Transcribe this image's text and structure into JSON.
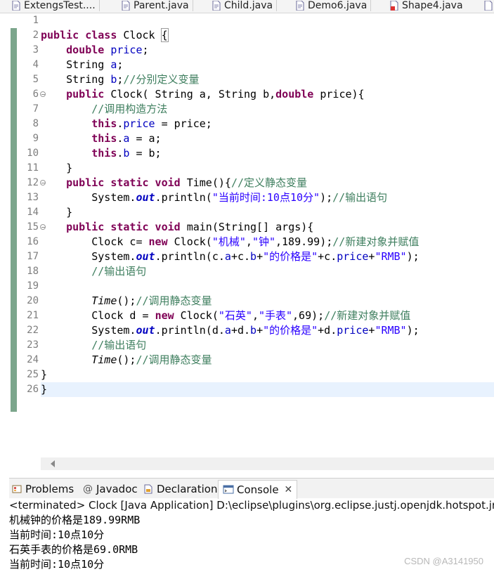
{
  "editor_tabs": [
    {
      "label": "ExtengsTest....",
      "icon": "java-file-icon"
    },
    {
      "label": "Parent.java",
      "icon": "java-file-icon"
    },
    {
      "label": "Child.java",
      "icon": "java-file-icon"
    },
    {
      "label": "Demo6.java",
      "icon": "java-file-icon"
    },
    {
      "label": "Shape4.java",
      "icon": "java-file-error-icon"
    }
  ],
  "line_numbers": [
    "1",
    "2",
    "3",
    "4",
    "5",
    "6",
    "7",
    "8",
    "9",
    "10",
    "11",
    "12",
    "13",
    "14",
    "15",
    "16",
    "17",
    "18",
    "19",
    "20",
    "21",
    "22",
    "23",
    "24",
    "25",
    "26"
  ],
  "code": {
    "l2_a": "public class",
    "l2_b": " Clock ",
    "l2_c": "{",
    "l3_a": "    ",
    "l3_b": "double",
    "l3_c": " ",
    "l3_d": "price",
    "l3_e": ";",
    "l4_a": "    String ",
    "l4_b": "a",
    "l4_c": ";",
    "l5_a": "    String ",
    "l5_b": "b",
    "l5_c": ";",
    "l5_d": "//分别定义变量",
    "l6_a": "    ",
    "l6_b": "public",
    "l6_c": " Clock( String a, String b,",
    "l6_d": "double",
    "l6_e": " price){",
    "l7_a": "        ",
    "l7_b": "//调用构造方法",
    "l8_a": "        ",
    "l8_b": "this",
    "l8_c": ".",
    "l8_d": "price",
    "l8_e": " = price;",
    "l9_a": "        ",
    "l9_b": "this",
    "l9_c": ".",
    "l9_d": "a",
    "l9_e": " = a;",
    "l10_a": "        ",
    "l10_b": "this",
    "l10_c": ".",
    "l10_d": "b",
    "l10_e": " = b;",
    "l11": "    }",
    "l12_a": "    ",
    "l12_b": "public static void",
    "l12_c": " Time(){",
    "l12_d": "//定义静态变量",
    "l13_a": "        System.",
    "l13_b": "out",
    "l13_c": ".println(",
    "l13_d": "\"当前时间:10点10分\"",
    "l13_e": ");",
    "l13_f": "//输出语句",
    "l14": "    }",
    "l15_a": "    ",
    "l15_b": "public static void",
    "l15_c": " main(String[] args){",
    "l16_a": "        Clock c= ",
    "l16_b": "new",
    "l16_c": " Clock(",
    "l16_d": "\"机械\"",
    "l16_e": ",",
    "l16_f": "\"钟\"",
    "l16_g": ",189.99);",
    "l16_h": "//新建对象并赋值",
    "l17_a": "        System.",
    "l17_b": "out",
    "l17_c": ".println(c.",
    "l17_d": "a",
    "l17_e": "+c.",
    "l17_f": "b",
    "l17_g": "+",
    "l17_h": "\"的价格是\"",
    "l17_i": "+c.",
    "l17_j": "price",
    "l17_k": "+",
    "l17_l": "\"RMB\"",
    "l17_m": ");",
    "l18_a": "        ",
    "l18_b": "//输出语句",
    "l20_a": "        ",
    "l20_b": "Time",
    "l20_c": "();",
    "l20_d": "//调用静态变量",
    "l21_a": "        Clock d = ",
    "l21_b": "new",
    "l21_c": " Clock(",
    "l21_d": "\"石英\"",
    "l21_e": ",",
    "l21_f": "\"手表\"",
    "l21_g": ",69);",
    "l21_h": "//新建对象并赋值",
    "l22_a": "        System.",
    "l22_b": "out",
    "l22_c": ".println(d.",
    "l22_d": "a",
    "l22_e": "+d.",
    "l22_f": "b",
    "l22_g": "+",
    "l22_h": "\"的价格是\"",
    "l22_i": "+d.",
    "l22_j": "price",
    "l22_k": "+",
    "l22_l": "\"RMB\"",
    "l22_m": ");",
    "l23_a": "        ",
    "l23_b": "//输出语句",
    "l24_a": "        ",
    "l24_b": "Time",
    "l24_c": "();",
    "l24_d": "//调用静态变量",
    "l25": "}",
    "l26": "}"
  },
  "panel_tabs": [
    {
      "label": "Problems",
      "icon": "problems-icon"
    },
    {
      "label": "Javadoc",
      "icon": "javadoc-icon"
    },
    {
      "label": "Declaration",
      "icon": "declaration-icon"
    },
    {
      "label": "Console",
      "icon": "console-icon",
      "active": true
    }
  ],
  "console": {
    "close_glyph": "✕",
    "terminated": "<terminated> Clock [Java Application] D:\\eclipse\\plugins\\org.eclipse.justj.openjdk.hotspot.jre.",
    "output": [
      "机械钟的价格是189.99RMB",
      "当前时间:10点10分",
      "石英手表的价格是69.0RMB",
      "当前时间:10点10分"
    ]
  },
  "watermark": "CSDN @A3141950",
  "colors": {
    "keyword": "#7f0055",
    "field": "#0000c0",
    "string": "#2a00ff",
    "comment": "#3f7f5f",
    "change_bar": "#7ca68c",
    "current_line": "#e8f2fe"
  }
}
